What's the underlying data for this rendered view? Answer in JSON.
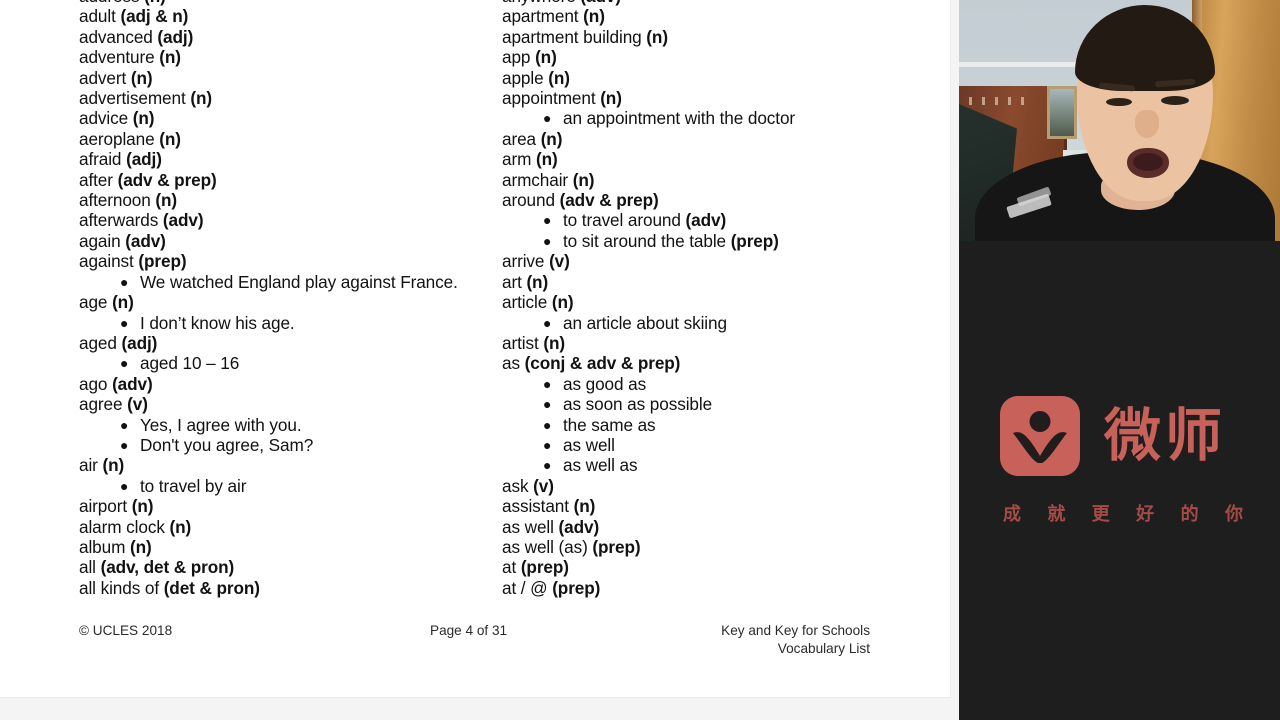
{
  "document": {
    "left_column": [
      {
        "type": "entry",
        "headword": "address ",
        "pos": "(n)"
      },
      {
        "type": "entry",
        "headword": "adult ",
        "pos": "(adj & n)"
      },
      {
        "type": "entry",
        "headword": "advanced ",
        "pos": "(adj)"
      },
      {
        "type": "entry",
        "headword": "adventure ",
        "pos": "(n)"
      },
      {
        "type": "entry",
        "headword": "advert ",
        "pos": "(n)"
      },
      {
        "type": "entry",
        "headword": "advertisement ",
        "pos": "(n)"
      },
      {
        "type": "entry",
        "headword": "advice ",
        "pos": "(n)"
      },
      {
        "type": "entry",
        "headword": "aeroplane ",
        "pos": "(n)"
      },
      {
        "type": "entry",
        "headword": "afraid ",
        "pos": "(adj)"
      },
      {
        "type": "entry",
        "headword": "after ",
        "pos": "(adv & prep)"
      },
      {
        "type": "entry",
        "headword": "afternoon ",
        "pos": "(n)"
      },
      {
        "type": "entry",
        "headword": "afterwards ",
        "pos": "(adv)"
      },
      {
        "type": "entry",
        "headword": "again ",
        "pos": "(adv)"
      },
      {
        "type": "entry",
        "headword": "against ",
        "pos": "(prep)"
      },
      {
        "type": "example",
        "text": "We watched England play against France.",
        "bold": ""
      },
      {
        "type": "entry",
        "headword": "age ",
        "pos": "(n)"
      },
      {
        "type": "example",
        "text": "I don’t know his age.",
        "bold": ""
      },
      {
        "type": "entry",
        "headword": "aged ",
        "pos": "(adj)"
      },
      {
        "type": "example",
        "text": "aged 10 – 16",
        "bold": ""
      },
      {
        "type": "entry",
        "headword": "ago ",
        "pos": "(adv)"
      },
      {
        "type": "entry",
        "headword": "agree ",
        "pos": "(v)"
      },
      {
        "type": "example",
        "text": "Yes, I agree with you.",
        "bold": ""
      },
      {
        "type": "example",
        "text": "Don't you agree, Sam?",
        "bold": ""
      },
      {
        "type": "entry",
        "headword": "air ",
        "pos": "(n)"
      },
      {
        "type": "example",
        "text": "to travel by air",
        "bold": ""
      },
      {
        "type": "entry",
        "headword": "airport ",
        "pos": "(n)"
      },
      {
        "type": "entry",
        "headword": "alarm clock ",
        "pos": "(n)"
      },
      {
        "type": "entry",
        "headword": "album ",
        "pos": "(n)"
      },
      {
        "type": "entry",
        "headword": "all ",
        "pos": "(adv, det & pron)"
      },
      {
        "type": "entry",
        "headword": "all kinds of ",
        "pos": "(det & pron)"
      }
    ],
    "right_column": [
      {
        "type": "entry",
        "headword": "anywhere ",
        "pos": "(adv)"
      },
      {
        "type": "entry",
        "headword": "apartment ",
        "pos": "(n)"
      },
      {
        "type": "entry",
        "headword": "apartment building ",
        "pos": "(n)"
      },
      {
        "type": "entry",
        "headword": "app ",
        "pos": "(n)"
      },
      {
        "type": "entry",
        "headword": "apple ",
        "pos": "(n)"
      },
      {
        "type": "entry",
        "headword": "appointment ",
        "pos": "(n)"
      },
      {
        "type": "example",
        "text": "an appointment with the doctor",
        "bold": ""
      },
      {
        "type": "entry",
        "headword": "area ",
        "pos": "(n)"
      },
      {
        "type": "entry",
        "headword": "arm ",
        "pos": "(n)"
      },
      {
        "type": "entry",
        "headword": "armchair ",
        "pos": "(n)"
      },
      {
        "type": "entry",
        "headword": "around ",
        "pos": "(adv & prep)"
      },
      {
        "type": "example",
        "text": "to travel around ",
        "bold": "(adv)"
      },
      {
        "type": "example",
        "text": "to sit around the table ",
        "bold": "(prep)"
      },
      {
        "type": "entry",
        "headword": "arrive ",
        "pos": "(v)"
      },
      {
        "type": "entry",
        "headword": "art ",
        "pos": "(n)"
      },
      {
        "type": "entry",
        "headword": "article ",
        "pos": "(n)"
      },
      {
        "type": "example",
        "text": "an article about skiing",
        "bold": ""
      },
      {
        "type": "entry",
        "headword": "artist ",
        "pos": "(n)"
      },
      {
        "type": "entry",
        "headword": "as ",
        "pos": "(conj & adv & prep)"
      },
      {
        "type": "example",
        "text": "as good as",
        "bold": ""
      },
      {
        "type": "example",
        "text": "as soon as possible",
        "bold": ""
      },
      {
        "type": "example",
        "text": "the same as",
        "bold": ""
      },
      {
        "type": "example",
        "text": "as well",
        "bold": ""
      },
      {
        "type": "example",
        "text": "as well as",
        "bold": ""
      },
      {
        "type": "entry",
        "headword": "ask ",
        "pos": "(v)"
      },
      {
        "type": "entry",
        "headword": "assistant ",
        "pos": "(n)"
      },
      {
        "type": "entry",
        "headword": "as well ",
        "pos": "(adv)"
      },
      {
        "type": "entry",
        "headword": "as well (as) ",
        "pos": "(prep)"
      },
      {
        "type": "entry",
        "headword": "at ",
        "pos": "(prep)"
      },
      {
        "type": "entry",
        "headword": "at / @ ",
        "pos": "(prep)"
      }
    ],
    "footer": {
      "copyright": "© UCLES 2018",
      "page": "Page 4 of 31",
      "title_line1": "Key and Key for Schools",
      "title_line2": "Vocabulary List"
    }
  },
  "sidebar": {
    "webcam": {
      "label": "presenter-video"
    },
    "logo": {
      "wordmark": "微师",
      "tagline": [
        "成",
        "就",
        "更",
        "好",
        "的",
        "你"
      ],
      "brand_color": "#c9615b",
      "background_color": "#1e1e1e"
    }
  }
}
